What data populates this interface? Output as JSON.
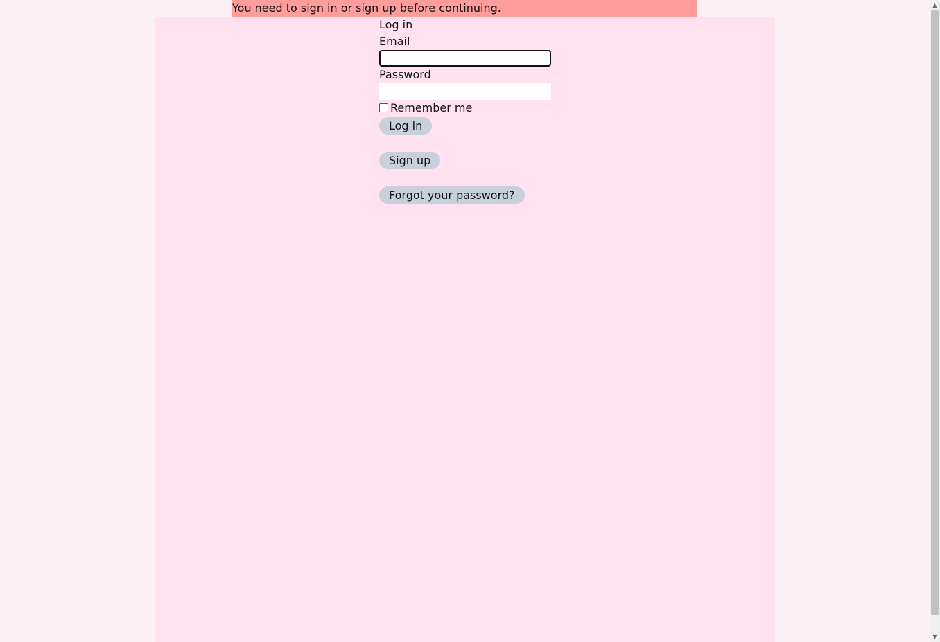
{
  "flash": {
    "message": "You need to sign in or sign up before continuing."
  },
  "form": {
    "title": "Log in",
    "email_label": "Email",
    "email_value": "",
    "password_label": "Password",
    "password_value": "",
    "remember_label": "Remember me",
    "remember_checked": false,
    "submit_label": "Log in"
  },
  "links": {
    "sign_up": "Sign up",
    "forgot_password": "Forgot your password?"
  },
  "scrollbar": {
    "up_icon": "triangle-up-icon",
    "down_icon": "triangle-down-icon"
  },
  "colors": {
    "page_background": "#fdf0f5",
    "panel_background": "#ffe1ef",
    "flash_background": "#ff9d9d",
    "button_background": "#c8d0dc"
  }
}
